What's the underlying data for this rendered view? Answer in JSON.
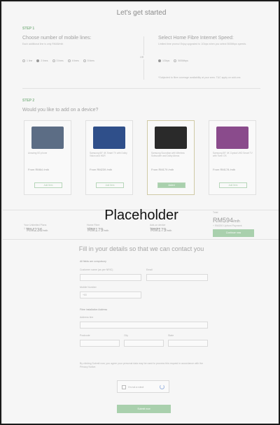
{
  "page": {
    "title": "Let's get started",
    "overlay_text": "Placeholder"
  },
  "step1": {
    "label": "STEP 1",
    "mobile": {
      "heading": "Choose number of mobile lines:",
      "note": "Each additional line is only RM48/mth",
      "options": [
        "1 line",
        "2 lines",
        "3 lines",
        "4 lines",
        "5 lines"
      ],
      "selected": 1
    },
    "or": "OR",
    "fibre": {
      "heading": "Select Home Fibre Internet Speed:",
      "note": "Limited time promo! Enjoy upgraded to 1Gbps when you select 500Mbps speeds.",
      "options": [
        "1Gbps",
        "500Mbps"
      ],
      "selected": 0
    },
    "footnote": "*Subjected to fibre coverage availability at your area. T&C apply on add-ons"
  },
  "step2": {
    "label": "STEP 2",
    "heading": "Would you like to add on a device?",
    "cards": [
      {
        "desc": "Amazing 5G phone",
        "price": "From RM64 /mth",
        "button": "Add Item",
        "selected": false,
        "color": "#5c6d85"
      },
      {
        "desc": "Samsung 65\" 4K Smart TV with Dolby Vision and HDR",
        "price": "From RM239 /mth",
        "button": "Add Item",
        "selected": false,
        "color": "#2f4f8a"
      },
      {
        "desc": "Samsung Soundbar with Wireless Subwoofer and Dolby Atmos",
        "price": "From RM179 /mth",
        "button": "Added",
        "selected": true,
        "color": "#2a2a2a"
      },
      {
        "desc": "Samsung 55\" 4K Crystal UHD Smart TV with Tizen OS",
        "price": "From RM178 /mth",
        "button": "Add Item",
        "selected": false,
        "color": "#8a4b8c"
      }
    ]
  },
  "summary": {
    "col1_label": "Your Unlimited Plans",
    "col1_sub": "1 line",
    "col1_price": "RM236",
    "col2_label": "Home Fibre",
    "col2_sub": "1 Gbps",
    "col2_price": "RM179",
    "col3_label": "Add-on device",
    "col3_sub": "Soundbar",
    "col3_price": "RM179",
    "per": "/mth",
    "total_label": "Total",
    "total": "RM594",
    "total_note": "+ RM200 Upfront Payment",
    "cta": "Continue now"
  },
  "form": {
    "heading": "Fill in your details so that we can contact you",
    "section1": "All fields are compulsory",
    "name_label": "Customer name (as per NRIC)",
    "email_label": "Email",
    "mobile_label": "Mobile Number",
    "mobile_prefix": "+60",
    "section2": "Fibre installation Address",
    "address_label": "Address line",
    "postcode_label": "Postcode",
    "city_label": "City",
    "state_label": "State",
    "consent": "By clicking Submit now, you agree your personal data may be used to process this request in accordance with the Privacy Notice.",
    "captcha_label": "I'm not a robot",
    "submit": "Submit now"
  }
}
